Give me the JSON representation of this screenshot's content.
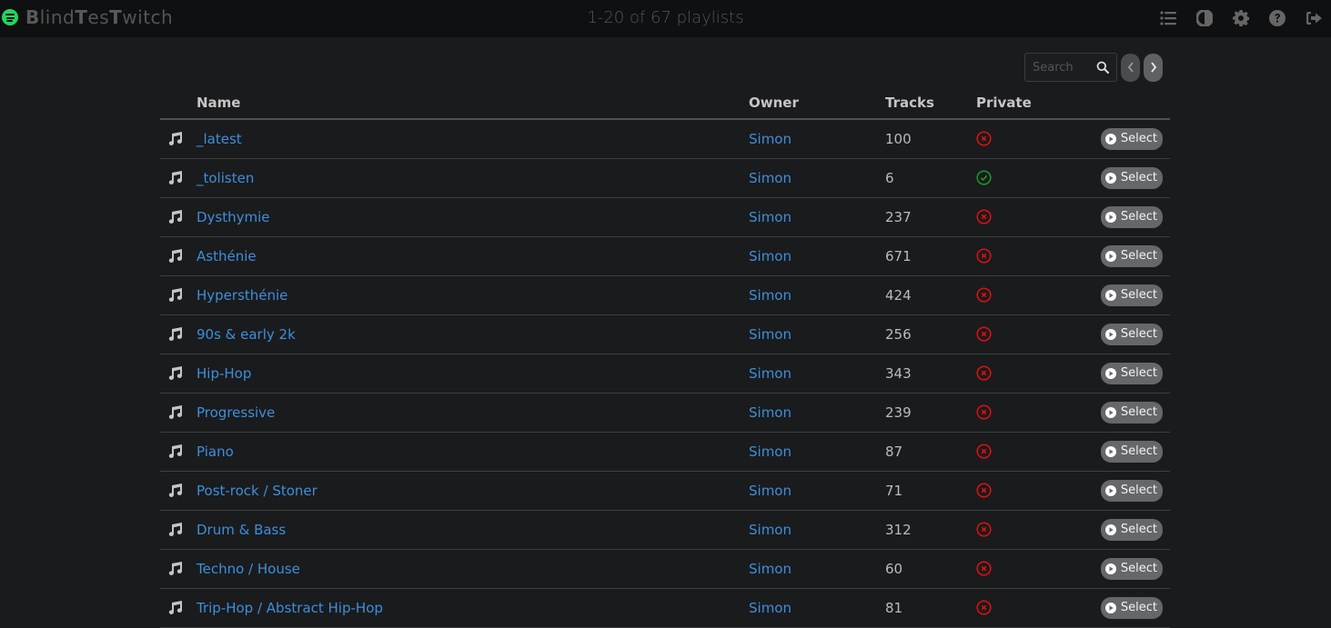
{
  "app": {
    "brand_prefix_1": "B",
    "brand_mid_1": "lind",
    "brand_prefix_2": "T",
    "brand_mid_2": "es",
    "brand_prefix_3": "T",
    "brand_mid_3": "witch",
    "logo_icon": "spotify-icon",
    "range_text": "1-20 of 67 playlists"
  },
  "top_icons": [
    "list-icon",
    "contrast-icon",
    "gear-icon",
    "help-icon",
    "logout-icon"
  ],
  "search": {
    "placeholder": "Search",
    "value": ""
  },
  "table": {
    "headers": {
      "name": "Name",
      "owner": "Owner",
      "tracks": "Tracks",
      "private": "Private"
    },
    "select_label": "Select",
    "colors": {
      "private_no": "#e01010",
      "private_yes": "#1a9a2a",
      "link": "#3d8fdb"
    },
    "rows": [
      {
        "name": "_latest",
        "owner": "Simon",
        "tracks": "100",
        "private": false
      },
      {
        "name": "_tolisten",
        "owner": "Simon",
        "tracks": "6",
        "private": true
      },
      {
        "name": "Dysthymie",
        "owner": "Simon",
        "tracks": "237",
        "private": false
      },
      {
        "name": "Asthénie",
        "owner": "Simon",
        "tracks": "671",
        "private": false
      },
      {
        "name": "Hypersthénie",
        "owner": "Simon",
        "tracks": "424",
        "private": false
      },
      {
        "name": "90s & early 2k",
        "owner": "Simon",
        "tracks": "256",
        "private": false
      },
      {
        "name": "Hip-Hop",
        "owner": "Simon",
        "tracks": "343",
        "private": false
      },
      {
        "name": "Progressive",
        "owner": "Simon",
        "tracks": "239",
        "private": false
      },
      {
        "name": "Piano",
        "owner": "Simon",
        "tracks": "87",
        "private": false
      },
      {
        "name": "Post-rock / Stoner",
        "owner": "Simon",
        "tracks": "71",
        "private": false
      },
      {
        "name": "Drum & Bass",
        "owner": "Simon",
        "tracks": "312",
        "private": false
      },
      {
        "name": "Techno / House",
        "owner": "Simon",
        "tracks": "60",
        "private": false
      },
      {
        "name": "Trip-Hop / Abstract Hip-Hop",
        "owner": "Simon",
        "tracks": "81",
        "private": false
      }
    ]
  }
}
